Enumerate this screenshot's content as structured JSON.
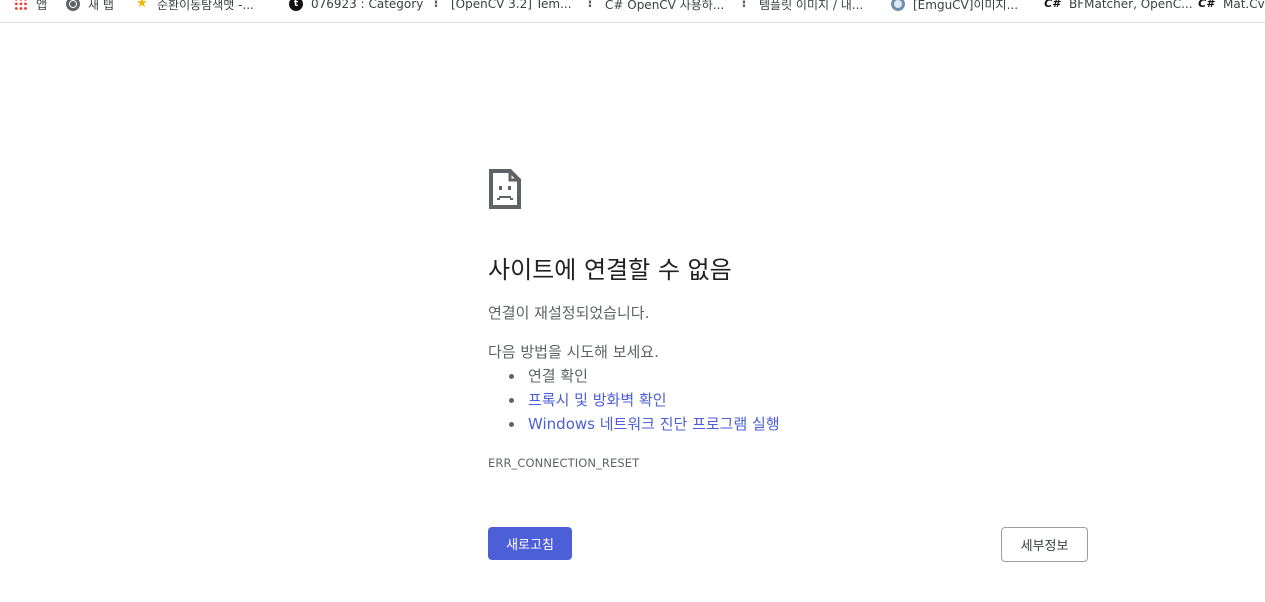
{
  "bookmarks": [
    {
      "icon": "apps-grid-icon",
      "label": "앱"
    },
    {
      "icon": "globe-icon",
      "label": "새 탭"
    },
    {
      "icon": "star-icon",
      "label": "순환이동탐색맷 -..."
    },
    {
      "icon": "tistory-icon",
      "label": "076923 : Category"
    },
    {
      "icon": "dots-icon",
      "label": "[OpenCV 3.2] Tem..."
    },
    {
      "icon": "dots-icon",
      "label": "C# OpenCV 사용하..."
    },
    {
      "icon": "dots-icon",
      "label": "템플릿 이미지 / 내..."
    },
    {
      "icon": "emgucv-icon",
      "label": "[EmguCV]이미지..."
    },
    {
      "icon": "csharp-icon",
      "label": "BFMatcher, OpenC..."
    },
    {
      "icon": "csharp-icon",
      "label": "Mat.Cvte"
    }
  ],
  "error": {
    "icon": "sad-page-icon",
    "title": "사이트에 연결할 수 없음",
    "subtitle": "연결이 재설정되었습니다.",
    "suggestions_intro": "다음 방법을 시도해 보세요.",
    "suggestions": [
      {
        "text": "연결 확인",
        "is_link": false
      },
      {
        "text": "프록시 및 방화벽 확인",
        "is_link": true
      },
      {
        "text": "Windows 네트워크 진단 프로그램 실행",
        "is_link": true
      }
    ],
    "code": "ERR_CONNECTION_RESET"
  },
  "buttons": {
    "reload": "새로고침",
    "details": "세부정보"
  },
  "colors": {
    "accent": "#4c5fd7",
    "text_secondary": "#5f6368",
    "heading": "#202124"
  }
}
